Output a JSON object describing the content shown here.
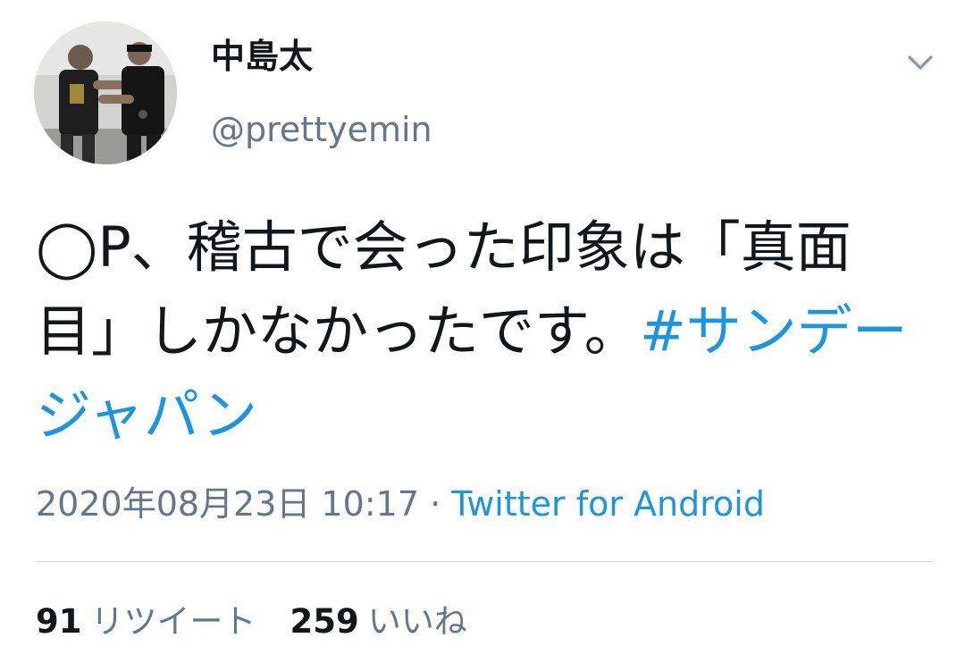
{
  "tweet": {
    "display_name": "中島太",
    "handle": "@prettyemin",
    "text": "◯P、稽古で会った印象は「真面目」しかなかったです。",
    "hashtag": "#サンデージャパン",
    "timestamp": "2020年08月23日 10:17",
    "separator": " · ",
    "source": "Twitter for Android",
    "retweets": {
      "count": "91",
      "label": "リツイート"
    },
    "likes": {
      "count": "259",
      "label": "いいね"
    }
  },
  "colors": {
    "link": "#1b95e0",
    "secondary_text": "#657786",
    "primary_text": "#14171a"
  },
  "icons": {
    "menu": "chevron-down-icon",
    "avatar": "avatar-photo"
  }
}
